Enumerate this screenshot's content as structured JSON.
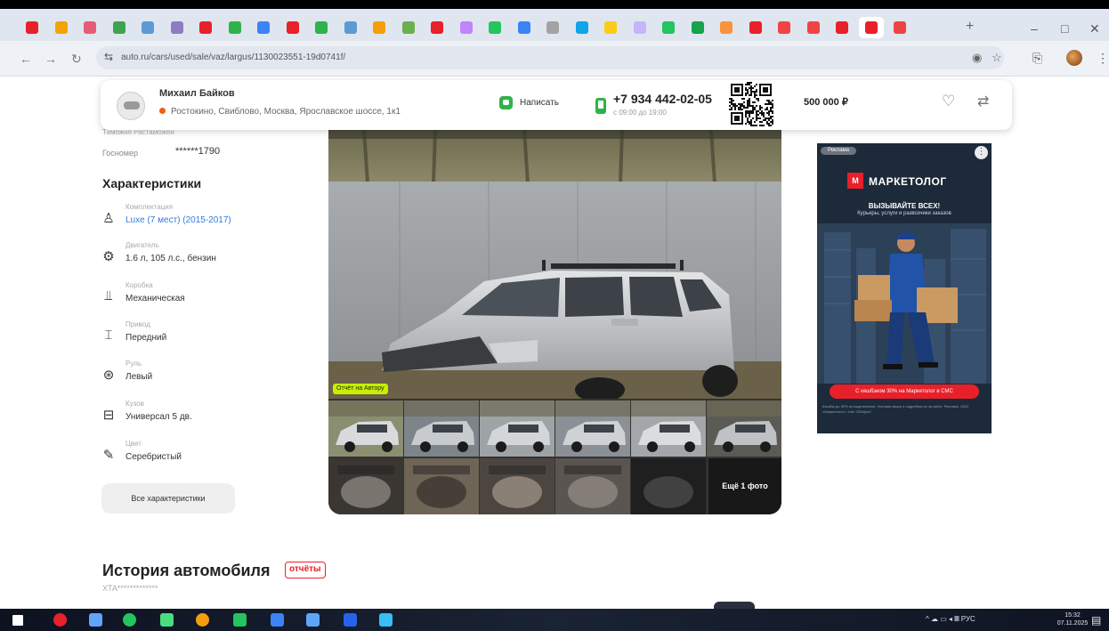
{
  "browser": {
    "url": "auto.ru/cars/used/sale/vaz/largus/1130023551-19d0741f/",
    "new_tab": "+",
    "win_min": "–",
    "win_max": "□",
    "win_close": "✕",
    "back": "←",
    "forward": "→",
    "reload": "↻",
    "site_info": "⇆",
    "eye": "◉",
    "star": "☆",
    "ext": "⎘",
    "more": "⋮",
    "tab_colors": [
      "#e8202a",
      "#f4a300",
      "#e85d75",
      "#3fa34d",
      "#5b9bd5",
      "#8e7cc3",
      "#e8202a",
      "#2eb34a",
      "#3b82f6",
      "#e8202a",
      "#2eb34a",
      "#5b9bd5",
      "#f59e0b",
      "#6ab04c",
      "#e8202a",
      "#c084fc",
      "#22c55e",
      "#3b82f6",
      "#a3a3a3",
      "#0ea5e9",
      "#facc15",
      "#c4b5fd",
      "#22c55e",
      "#16a34a",
      "#fb923c",
      "#e8202a",
      "#ef4444",
      "#ef4444",
      "#e8202a",
      "#e8202a",
      "#ef4444"
    ]
  },
  "seller": {
    "name": "Михаил Байков",
    "address": "Ростокино, Свиблово, Москва, Ярославское шоссе, 1к1",
    "write_label": "Написать",
    "phone": "+7 934 442-02-05",
    "phone_hours": "с 09:00 до 19:00",
    "price": "500 000 ₽",
    "heart": "♡",
    "compare": "⇄"
  },
  "left": {
    "hidden_row": "Таможня  Растаможен",
    "gos_label": "Госномер",
    "gos_value": "******1790",
    "char_title": "Характеристики",
    "characteristics": [
      {
        "icon": "♙",
        "label": "Комплектация",
        "value": "Luxe (7 мест) (2015-2017)",
        "link": true
      },
      {
        "icon": "⚙",
        "label": "Двигатель",
        "value": "1.6 л, 105 л.с., бензин",
        "link": false
      },
      {
        "icon": "⫫",
        "label": "Коробка",
        "value": "Механическая",
        "link": false
      },
      {
        "icon": "⌶",
        "label": "Привод",
        "value": "Передний",
        "link": false
      },
      {
        "icon": "⊛",
        "label": "Руль",
        "value": "Левый",
        "link": false
      },
      {
        "icon": "⊟",
        "label": "Кузов",
        "value": "Универсал 5 дв.",
        "link": false
      },
      {
        "icon": "✎",
        "label": "Цвет",
        "value": "Серебристый",
        "link": false
      }
    ],
    "all_chars": "Все характеристики"
  },
  "gallery": {
    "badge": "Отчёт на Автору",
    "more_photos": "Ещё 1 фото"
  },
  "ad": {
    "tag": "Реклама",
    "menu": "⋮",
    "brand": "МАРКЕТОЛОГ",
    "logo_letter": "М",
    "headline": "ВЫЗЫВАЙТЕ ВСЕХ!",
    "sub": "Курьеры, услуги и развозчики заказов",
    "cta": "С кешбэком 30% на Маркетолог в СМС",
    "fine": "Кешбэк до 30% за подключение. Условия акции и подробности на сайте. Реклама. ООО «Маркетолог». erid: 2SDnjdv9"
  },
  "history": {
    "title": "История автомобиля",
    "badge": "отчёты",
    "vin": "XTA*************"
  },
  "taskbar": {
    "tray": "^ ☁ ▭ ◂ 𝄜 РУС",
    "time": "15:32",
    "date": "07.11.2025",
    "notif": "▤",
    "app_colors": [
      "#ffffff",
      "#e8202a",
      "#60a5fa",
      "#22c55e",
      "#4ade80",
      "#f59e0b",
      "#22c55e",
      "#3b82f6",
      "#60a5fa",
      "#2563eb",
      "#38bdf8"
    ]
  }
}
